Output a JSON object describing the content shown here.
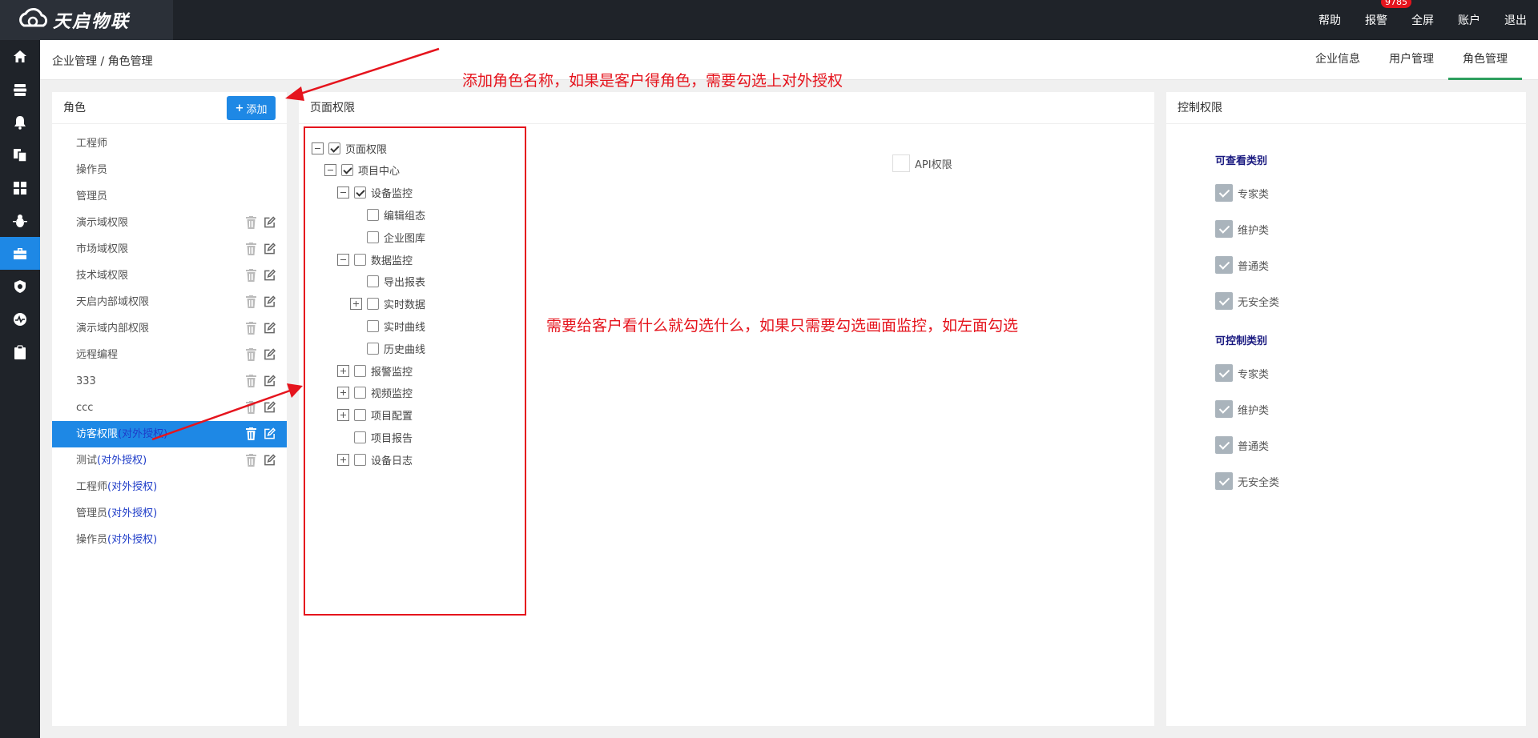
{
  "app": {
    "logo_text": "天启物联"
  },
  "topnav": {
    "help": "帮助",
    "alarm": "报警",
    "alarm_count": "9785",
    "fullscreen": "全屏",
    "account": "账户",
    "logout": "退出"
  },
  "sidebar": {
    "items": [
      {
        "icon": "home-icon"
      },
      {
        "icon": "server-icon"
      },
      {
        "icon": "bell-icon"
      },
      {
        "icon": "copy-icon"
      },
      {
        "icon": "dashboard-icon"
      },
      {
        "icon": "bug-icon"
      },
      {
        "icon": "briefcase-icon",
        "active": true
      },
      {
        "icon": "shield-icon"
      },
      {
        "icon": "pulse-icon"
      },
      {
        "icon": "clipboard-icon"
      }
    ]
  },
  "breadcrumb": "企业管理 / 角色管理",
  "tabs": [
    "企业信息",
    "用户管理",
    "角色管理"
  ],
  "roles": {
    "title": "角色",
    "add_label": "添加",
    "items": [
      {
        "name": "工程师",
        "ext": ""
      },
      {
        "name": "操作员",
        "ext": ""
      },
      {
        "name": "管理员",
        "ext": ""
      },
      {
        "name": "演示域权限",
        "ext": ""
      },
      {
        "name": "市场域权限",
        "ext": ""
      },
      {
        "name": "技术域权限",
        "ext": ""
      },
      {
        "name": "天启内部域权限",
        "ext": ""
      },
      {
        "name": "演示域内部权限",
        "ext": ""
      },
      {
        "name": "远程编程",
        "ext": ""
      },
      {
        "name": "333",
        "ext": ""
      },
      {
        "name": "ccc",
        "ext": ""
      },
      {
        "name": "访客权限",
        "ext": "(对外授权)"
      },
      {
        "name": "测试",
        "ext": "(对外授权)"
      },
      {
        "name": "工程师",
        "ext": "(对外授权)"
      },
      {
        "name": "管理员",
        "ext": "(对外授权)"
      },
      {
        "name": "操作员",
        "ext": "(对外授权)"
      }
    ]
  },
  "page_permissions": {
    "title": "页面权限",
    "tree": [
      {
        "label": "页面权限",
        "toggle": "minus",
        "checked": true
      },
      {
        "label": "项目中心",
        "toggle": "minus",
        "checked": true
      },
      {
        "label": "设备监控",
        "toggle": "minus",
        "checked": true
      },
      {
        "label": "编辑组态",
        "toggle": "none",
        "checked": false
      },
      {
        "label": "企业图库",
        "toggle": "none",
        "checked": false
      },
      {
        "label": "数据监控",
        "toggle": "minus",
        "checked": false
      },
      {
        "label": "导出报表",
        "toggle": "none",
        "checked": false
      },
      {
        "label": "实时数据",
        "toggle": "plus",
        "checked": false
      },
      {
        "label": "实时曲线",
        "toggle": "none",
        "checked": false
      },
      {
        "label": "历史曲线",
        "toggle": "none",
        "checked": false
      },
      {
        "label": "报警监控",
        "toggle": "plus",
        "checked": false
      },
      {
        "label": "视频监控",
        "toggle": "plus",
        "checked": false
      },
      {
        "label": "项目配置",
        "toggle": "plus",
        "checked": false
      },
      {
        "label": "项目报告",
        "toggle": "none",
        "checked": false
      },
      {
        "label": "设备日志",
        "toggle": "plus",
        "checked": false
      }
    ],
    "api_label": "API权限"
  },
  "control_permissions": {
    "title": "控制权限",
    "view_heading": "可查看类别",
    "view_items": [
      "专家类",
      "维护类",
      "普通类",
      "无安全类"
    ],
    "control_heading": "可控制类别",
    "control_items": [
      "专家类",
      "维护类",
      "普通类",
      "无安全类"
    ]
  },
  "annotations": {
    "add_note": "添加角色名称，如果是客户得角色，需要勾选上对外授权",
    "check_note": "需要给客户看什么就勾选什么，如果只需要勾选画面监控，如左面勾选"
  },
  "colors": {
    "topbar": "#1f2329",
    "accent": "#1e88e5",
    "annotation": "#e5141d",
    "tab_active": "#2e9f5e",
    "ext_text": "#1e3cc8"
  }
}
